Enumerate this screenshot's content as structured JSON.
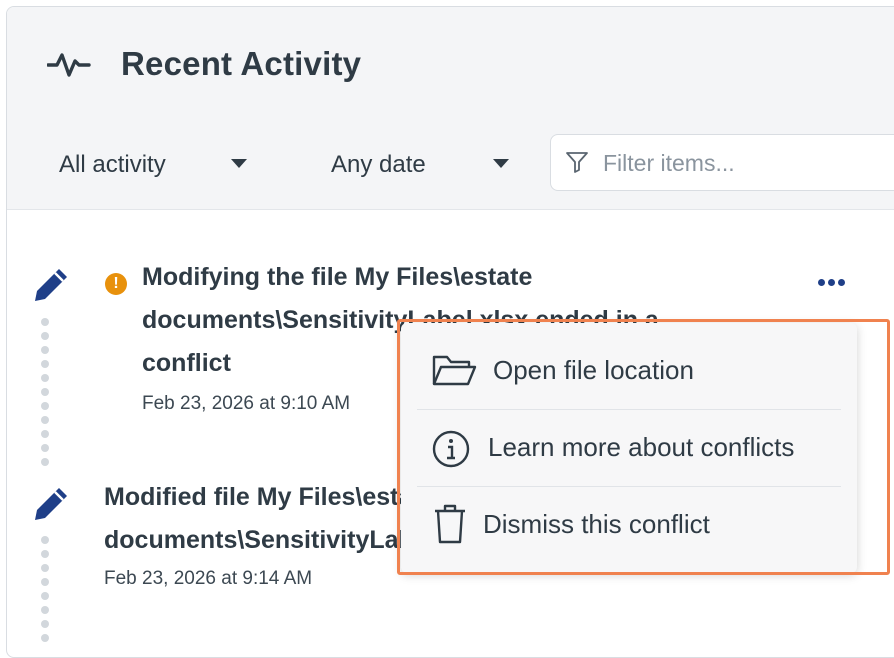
{
  "header": {
    "title": "Recent Activity",
    "icon": "activity-pulse-icon"
  },
  "filters": {
    "activity": {
      "value": "All activity"
    },
    "date": {
      "value": "Any date"
    },
    "search": {
      "placeholder": "Filter items...",
      "value": ""
    }
  },
  "items": [
    {
      "title_lines": [
        "Modifying the file My Files\\estate",
        "documents\\SensitivityLabel.xlsx ended in a",
        "conflict"
      ],
      "date": "Feb 23, 2026 at 9:10 AM",
      "status": "warning",
      "icon": "pencil-icon"
    },
    {
      "title_lines": [
        "Modified file My Files\\estate",
        "documents\\SensitivityLabel.xlsx"
      ],
      "date": "Feb 23, 2026 at 9:14 AM",
      "icon": "pencil-icon"
    }
  ],
  "context_menu": {
    "items": [
      {
        "label": "Open file location",
        "icon": "folder-open-icon"
      },
      {
        "label": "Learn more about conflicts",
        "icon": "info-icon"
      },
      {
        "label": "Dismiss this conflict",
        "icon": "trash-icon"
      }
    ]
  },
  "colors": {
    "accent": "#1f3f88",
    "warning": "#e8910c",
    "highlight": "#f0824f",
    "text": "#2f3b45"
  }
}
